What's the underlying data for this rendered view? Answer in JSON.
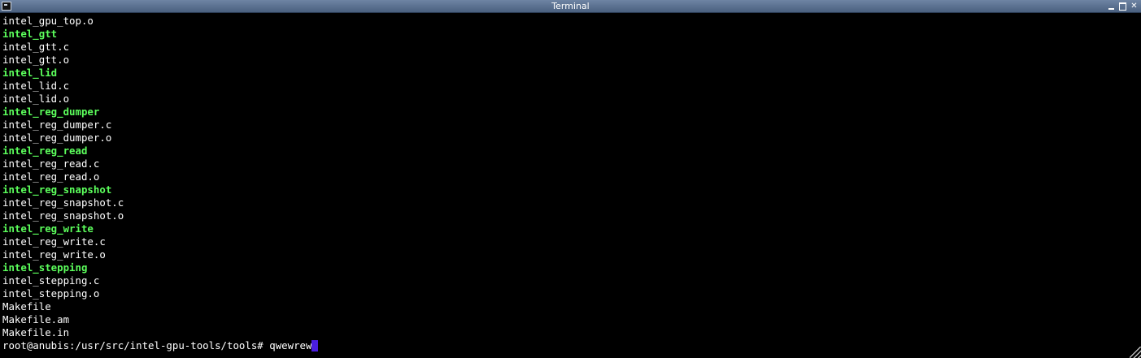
{
  "window": {
    "title": "Terminal",
    "icon": "terminal-icon",
    "controls": [
      "minimize-icon",
      "maximize-icon",
      "close-icon"
    ]
  },
  "colors": {
    "background": "#000000",
    "text": "#ffffff",
    "directory": "#5cff5c",
    "cursor": "#4a1ee0",
    "titlebar": "#5a7090"
  },
  "terminal": {
    "lines": [
      {
        "text": "intel_gpu_top.o",
        "kind": "file"
      },
      {
        "text": "intel_gtt",
        "kind": "dir"
      },
      {
        "text": "intel_gtt.c",
        "kind": "file"
      },
      {
        "text": "intel_gtt.o",
        "kind": "file"
      },
      {
        "text": "intel_lid",
        "kind": "dir"
      },
      {
        "text": "intel_lid.c",
        "kind": "file"
      },
      {
        "text": "intel_lid.o",
        "kind": "file"
      },
      {
        "text": "intel_reg_dumper",
        "kind": "dir"
      },
      {
        "text": "intel_reg_dumper.c",
        "kind": "file"
      },
      {
        "text": "intel_reg_dumper.o",
        "kind": "file"
      },
      {
        "text": "intel_reg_read",
        "kind": "dir"
      },
      {
        "text": "intel_reg_read.c",
        "kind": "file"
      },
      {
        "text": "intel_reg_read.o",
        "kind": "file"
      },
      {
        "text": "intel_reg_snapshot",
        "kind": "dir"
      },
      {
        "text": "intel_reg_snapshot.c",
        "kind": "file"
      },
      {
        "text": "intel_reg_snapshot.o",
        "kind": "file"
      },
      {
        "text": "intel_reg_write",
        "kind": "dir"
      },
      {
        "text": "intel_reg_write.c",
        "kind": "file"
      },
      {
        "text": "intel_reg_write.o",
        "kind": "file"
      },
      {
        "text": "intel_stepping",
        "kind": "dir"
      },
      {
        "text": "intel_stepping.c",
        "kind": "file"
      },
      {
        "text": "intel_stepping.o",
        "kind": "file"
      },
      {
        "text": "Makefile",
        "kind": "file"
      },
      {
        "text": "Makefile.am",
        "kind": "file"
      },
      {
        "text": "Makefile.in",
        "kind": "file"
      }
    ],
    "prompt": "root@anubis:/usr/src/intel-gpu-tools/tools# ",
    "input": "qwewrew"
  }
}
